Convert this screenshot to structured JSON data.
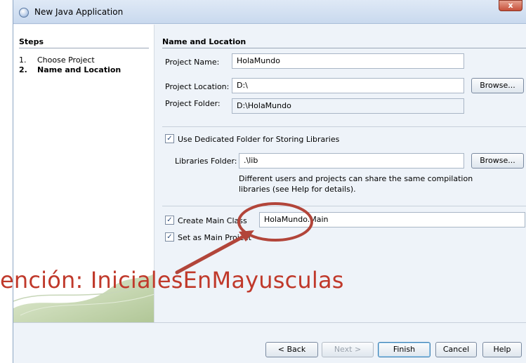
{
  "window": {
    "title": "New Java Application",
    "close_label": "x"
  },
  "steps": {
    "heading": "Steps",
    "items": [
      {
        "num": "1.",
        "label": "Choose Project"
      },
      {
        "num": "2.",
        "label": "Name and Location"
      }
    ]
  },
  "section": {
    "heading": "Name and Location"
  },
  "form": {
    "project_name_label": "Project Name:",
    "project_name_value": "HolaMundo",
    "project_location_label": "Project Location:",
    "project_location_value": "D:\\",
    "browse1_label": "Browse...",
    "project_folder_label": "Project Folder:",
    "project_folder_value": "D:\\HolaMundo",
    "dedicated_folder_label": "Use Dedicated Folder for Storing Libraries",
    "libraries_folder_label": "Libraries Folder:",
    "libraries_folder_value": ".\\lib",
    "browse2_label": "Browse...",
    "help_line1": "Different users and projects can share the same compilation",
    "help_line2": "libraries (see Help for details).",
    "create_main_class_label": "Create Main Class",
    "create_main_class_value": "HolaMundo.Main",
    "set_main_project_label": "Set as Main Project"
  },
  "buttons": {
    "back": "< Back",
    "next": "Next >",
    "finish": "Finish",
    "cancel": "Cancel",
    "help": "Help"
  },
  "annotation": {
    "text": "ención: InicialesEnMayusculas",
    "color": "#c0392b"
  }
}
